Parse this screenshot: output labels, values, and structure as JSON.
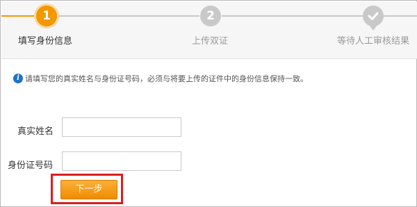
{
  "steps": [
    {
      "number": "1",
      "label": "填写身份信息",
      "state": "active"
    },
    {
      "number": "2",
      "label": "上传双证",
      "state": "inactive"
    },
    {
      "number": "",
      "label": "等待人工审核结果",
      "state": "inactive",
      "icon": "check-pin-icon"
    }
  ],
  "notice": {
    "icon": "info-icon",
    "icon_glyph": "i",
    "text": "请填写您的真实姓名与身份证号码，必须与将要上传的证件中的身份信息保持一致。"
  },
  "form": {
    "name_label": "真实姓名",
    "name_value": "",
    "id_label": "身份证号码",
    "id_value": ""
  },
  "actions": {
    "next_label": "下一步"
  },
  "colors": {
    "accent": "#f39800",
    "inactive_step": "#c9c9c9",
    "highlight": "#d81e1e",
    "info": "#1e73c6"
  }
}
